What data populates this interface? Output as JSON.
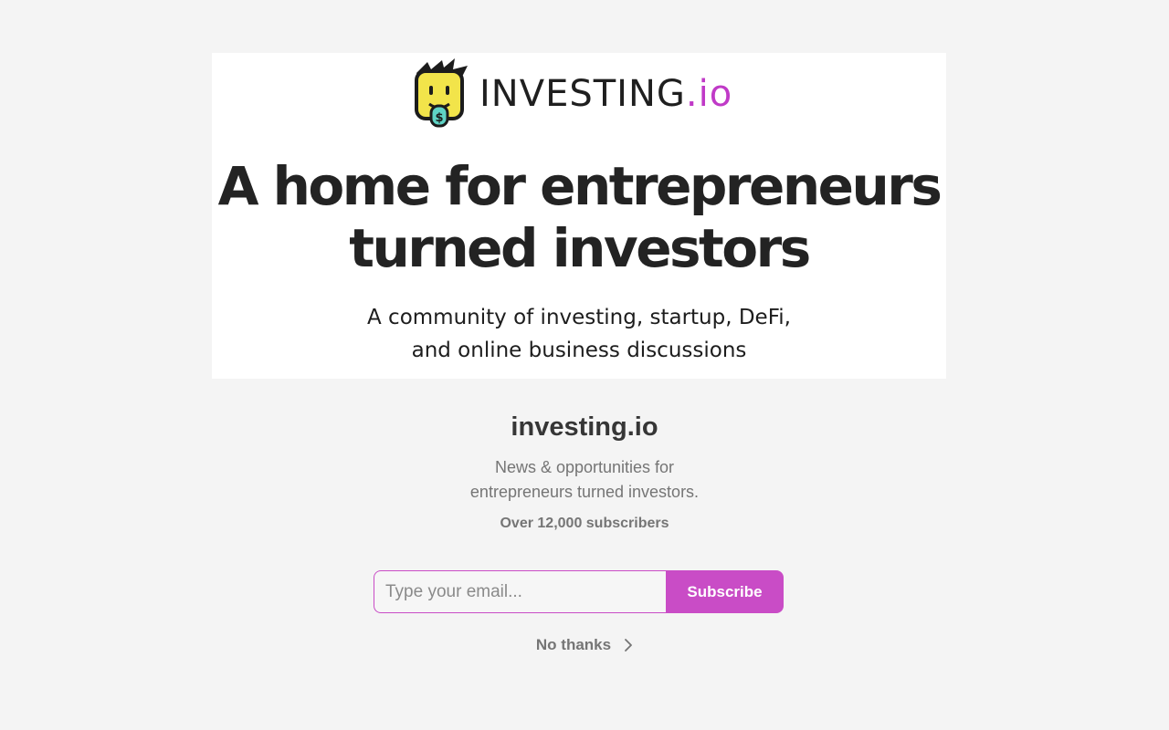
{
  "banner": {
    "logo": {
      "mark_icon": "smiley-dollar-logo-icon",
      "word_main": "INVESTING",
      "word_accent": ".io"
    },
    "headline_line1": "A home for entrepreneurs",
    "headline_line2": "turned investors",
    "subhead_line1": "A community of investing, startup, DeFi,",
    "subhead_line2": "and online business discussions"
  },
  "publication": {
    "title": "investing.io",
    "description_line1": "News & opportunities for",
    "description_line2": "entrepreneurs turned investors.",
    "subscribers": "Over 12,000 subscribers"
  },
  "form": {
    "email_value": "",
    "email_placeholder": "Type your email...",
    "subscribe_label": "Subscribe"
  },
  "dismiss": {
    "label": "No thanks",
    "icon": "chevron-right-icon"
  },
  "colors": {
    "accent": "#c94cc6",
    "background": "#f4f4f4",
    "banner_bg": "#ffffff",
    "logo_yellow": "#f2e44a",
    "logo_teal": "#5fd3c5"
  }
}
